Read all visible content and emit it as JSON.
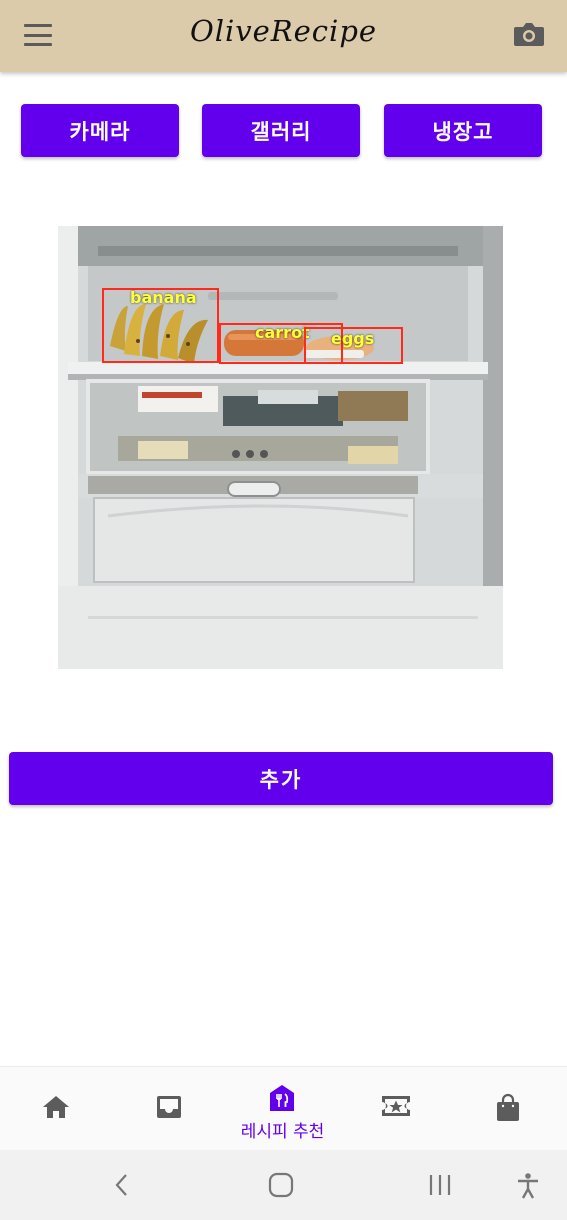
{
  "app": {
    "title": "OliveRecipe",
    "colors": {
      "appbar": "#dccbaa",
      "primary": "#6200ee"
    },
    "icons": {
      "menu": "hamburger-menu-icon",
      "camera": "camera-icon"
    }
  },
  "actions": [
    {
      "label": "카메라"
    },
    {
      "label": "갤러리"
    },
    {
      "label": "냉장고"
    }
  ],
  "detections": [
    {
      "label": "banana",
      "color": "#ff2a1a",
      "label_color": "#ffff33"
    },
    {
      "label": "carrot",
      "color": "#ff2a1a",
      "label_color": "#ffff33"
    },
    {
      "label": "eggs",
      "color": "#ff2a1a",
      "label_color": "#ffff33"
    }
  ],
  "add_button": {
    "label": "추가"
  },
  "bottom_nav": {
    "items": [
      {
        "icon": "home-icon"
      },
      {
        "icon": "inbox-icon"
      },
      {
        "icon": "restaurant-icon",
        "label": "레시피 추천",
        "active": true
      },
      {
        "icon": "ticket-star-icon"
      },
      {
        "icon": "shopping-bag-icon"
      }
    ]
  },
  "system_nav": [
    "back-icon",
    "home-circle-icon",
    "recents-icon",
    "accessibility-icon"
  ]
}
